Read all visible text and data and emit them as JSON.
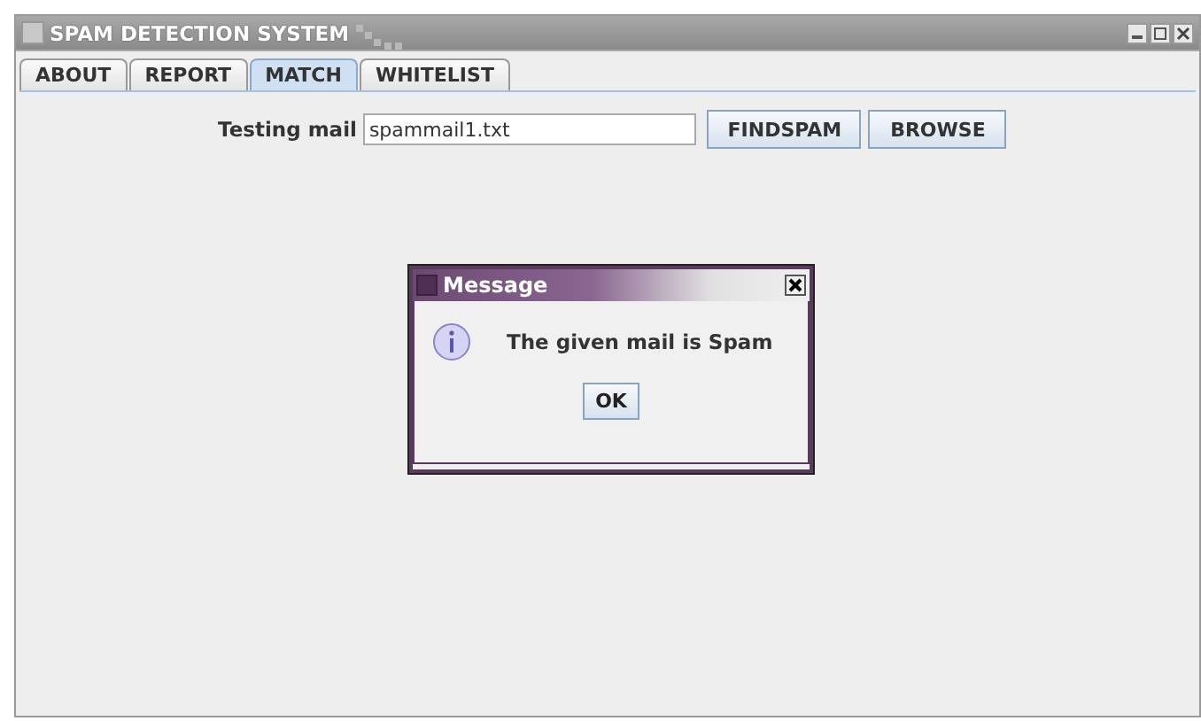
{
  "window": {
    "title": "SPAM DETECTION SYSTEM"
  },
  "tabs": [
    {
      "label": "ABOUT",
      "selected": false
    },
    {
      "label": "REPORT",
      "selected": false
    },
    {
      "label": "MATCH",
      "selected": true
    },
    {
      "label": "WHITELIST",
      "selected": false
    }
  ],
  "form": {
    "label": "Testing mail",
    "value": "spammail1.txt",
    "buttons": [
      "FINDSPAM",
      "BROWSE"
    ]
  },
  "dialog": {
    "title": "Message",
    "message": "The given mail is Spam",
    "button": "OK"
  }
}
